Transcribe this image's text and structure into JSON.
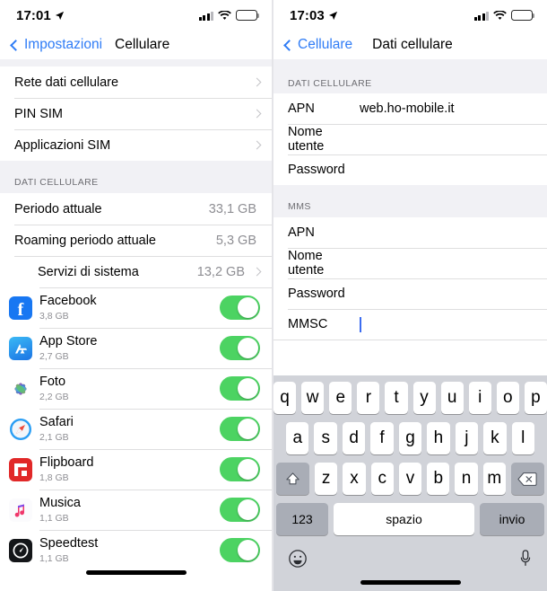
{
  "left_screen": {
    "status_bar": {
      "time": "17:01",
      "location_icon": "location-arrow-icon",
      "signal_icon": "cellular-signal-icon",
      "wifi_icon": "wifi-icon",
      "battery_icon": "battery-icon"
    },
    "nav": {
      "back_label": "Impostazioni",
      "title": "Cellulare",
      "back_icon": "chevron-left-icon"
    },
    "top_group": [
      {
        "label": "Rete dati cellulare",
        "accessory": "chevron-right-icon"
      },
      {
        "label": "PIN SIM",
        "accessory": "chevron-right-icon"
      },
      {
        "label": "Applicazioni SIM",
        "accessory": "chevron-right-icon"
      }
    ],
    "section_header": "DATI CELLULARE",
    "usage_rows": [
      {
        "label": "Periodo attuale",
        "value": "33,1 GB",
        "accessory": ""
      },
      {
        "label": "Roaming periodo attuale",
        "value": "5,3 GB",
        "accessory": ""
      },
      {
        "label": "Servizi di sistema",
        "value": "13,2 GB",
        "accessory": "chevron-right-icon",
        "indent": true
      }
    ],
    "apps": [
      {
        "name": "Facebook",
        "size": "3,8 GB",
        "icon": "facebook-icon",
        "enabled": true
      },
      {
        "name": "App Store",
        "size": "2,7 GB",
        "icon": "app-store-icon",
        "enabled": true
      },
      {
        "name": "Foto",
        "size": "2,2 GB",
        "icon": "photos-icon",
        "enabled": true
      },
      {
        "name": "Safari",
        "size": "2,1 GB",
        "icon": "safari-icon",
        "enabled": true
      },
      {
        "name": "Flipboard",
        "size": "1,8 GB",
        "icon": "flipboard-icon",
        "enabled": true
      },
      {
        "name": "Musica",
        "size": "1,1 GB",
        "icon": "music-icon",
        "enabled": true
      },
      {
        "name": "Speedtest",
        "size": "1,1 GB",
        "icon": "speedtest-icon",
        "enabled": true
      }
    ]
  },
  "right_screen": {
    "status_bar": {
      "time": "17:03",
      "location_icon": "location-arrow-icon",
      "signal_icon": "cellular-signal-icon",
      "wifi_icon": "wifi-icon",
      "battery_icon": "battery-icon"
    },
    "nav": {
      "back_label": "Cellulare",
      "title": "Dati cellulare",
      "back_icon": "chevron-left-icon"
    },
    "sections": [
      {
        "header": "DATI CELLULARE",
        "fields": [
          {
            "label": "APN",
            "value": "web.ho-mobile.it",
            "placeholder": "",
            "focused": false
          },
          {
            "label": "Nome utente",
            "value": "",
            "placeholder": "",
            "focused": false
          },
          {
            "label": "Password",
            "value": "",
            "placeholder": "",
            "focused": false
          }
        ]
      },
      {
        "header": "MMS",
        "fields": [
          {
            "label": "APN",
            "value": "",
            "placeholder": "",
            "focused": false
          },
          {
            "label": "Nome utente",
            "value": "",
            "placeholder": "",
            "focused": false
          },
          {
            "label": "Password",
            "value": "",
            "placeholder": "",
            "focused": false
          },
          {
            "label": "MMSC",
            "value": "",
            "placeholder": "",
            "focused": true
          }
        ]
      }
    ],
    "keyboard": {
      "row1": [
        "q",
        "w",
        "e",
        "r",
        "t",
        "y",
        "u",
        "i",
        "o",
        "p"
      ],
      "row2": [
        "a",
        "s",
        "d",
        "f",
        "g",
        "h",
        "j",
        "k",
        "l"
      ],
      "row3": [
        "z",
        "x",
        "c",
        "v",
        "b",
        "n",
        "m"
      ],
      "shift_icon": "shift-icon",
      "delete_icon": "backspace-icon",
      "numeric_label": "123",
      "space_label": "spazio",
      "return_label": "invio",
      "emoji_icon": "emoji-icon",
      "dictation_icon": "microphone-icon"
    }
  },
  "colors": {
    "accent": "#2f7cf6",
    "toggle_on": "#4cd362",
    "group_bg": "#f1f1f5",
    "separator": "#dededf",
    "secondary_text": "#8e8e93",
    "keyboard_bg": "#d1d3d9",
    "caret": "#3c6df0"
  }
}
